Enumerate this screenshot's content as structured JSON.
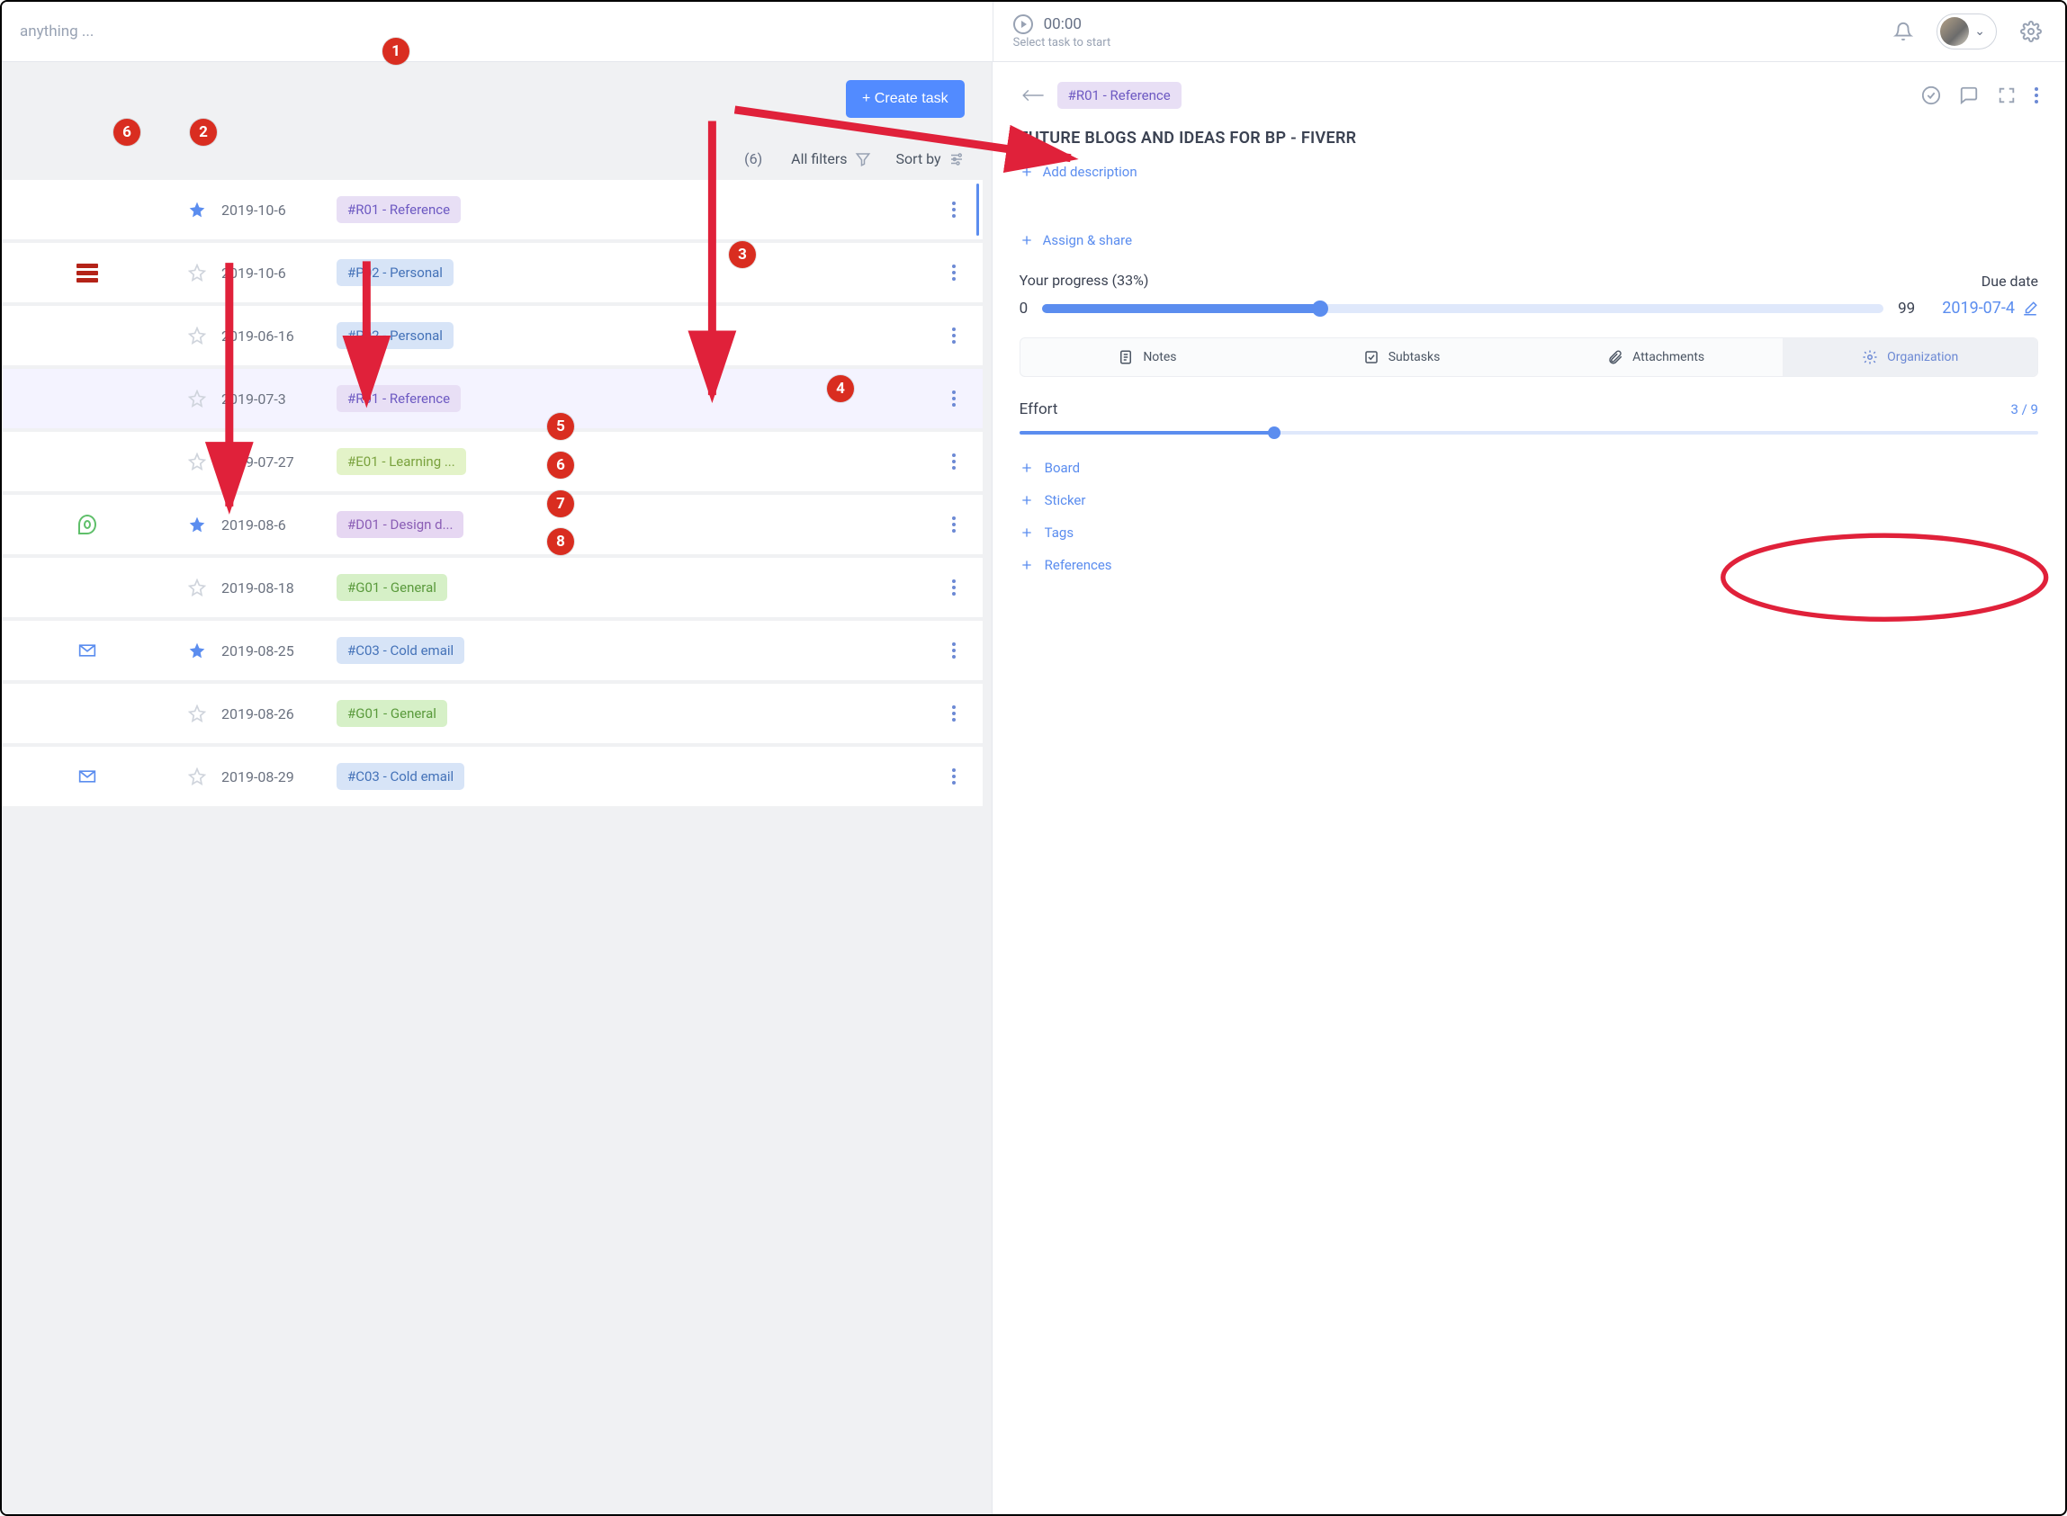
{
  "top": {
    "search_placeholder": "anything ...",
    "timer_time": "00:00",
    "timer_hint": "Select task to start"
  },
  "list": {
    "create_label": "+ Create task",
    "count_label": "(6)",
    "filters_label": "All filters",
    "sort_label": "Sort by",
    "rows": [
      {
        "date": "2019-10-6",
        "tag_text": "#R01 - Reference",
        "tag_class": "b-purple",
        "star": "fill",
        "sticker": "",
        "indicator": true
      },
      {
        "date": "2019-10-6",
        "tag_text": "#P02 - Personal",
        "tag_class": "b-blue",
        "star": "outline",
        "sticker": "stack"
      },
      {
        "date": "2019-06-16",
        "tag_text": "#P02 - Personal",
        "tag_class": "b-blue",
        "star": "outline",
        "sticker": ""
      },
      {
        "date": "2019-07-3",
        "tag_text": "#R01 - Reference",
        "tag_class": "b-purple",
        "star": "outline",
        "sticker": "",
        "selected": true
      },
      {
        "date": "2019-07-27",
        "tag_text": "#E01 - Learning ...",
        "tag_class": "b-lime",
        "star": "outline",
        "sticker": ""
      },
      {
        "date": "2019-08-6",
        "tag_text": "#D01 - Design d...",
        "tag_class": "b-violet",
        "star": "fill",
        "sticker": "spiral"
      },
      {
        "date": "2019-08-18",
        "tag_text": "#G01 - General",
        "tag_class": "b-green",
        "star": "outline",
        "sticker": ""
      },
      {
        "date": "2019-08-25",
        "tag_text": "#C03 - Cold email",
        "tag_class": "b-blue",
        "star": "fill",
        "sticker": "envelope"
      },
      {
        "date": "2019-08-26",
        "tag_text": "#G01 - General",
        "tag_class": "b-green",
        "star": "outline",
        "sticker": ""
      },
      {
        "date": "2019-08-29",
        "tag_text": "#C03 - Cold email",
        "tag_class": "b-blue",
        "star": "outline",
        "sticker": "envelope"
      }
    ]
  },
  "detail": {
    "tag_text": "#R01 - Reference",
    "title": "FUTURE BLOGS AND IDEAS FOR BP - FIVERR",
    "add_description": "Add description",
    "assign_share": "Assign & share",
    "progress_label": "Your progress  (33%)",
    "progress_min": "0",
    "progress_max": "99",
    "progress_percent": 33,
    "due_label": "Due date",
    "due_value": "2019-07-4",
    "tabs": {
      "notes": "Notes",
      "subtasks": "Subtasks",
      "attachments": "Attachments",
      "organization": "Organization"
    },
    "effort_label": "Effort",
    "effort_display": "3 / 9",
    "effort_percent": 25,
    "adds": {
      "board": "Board",
      "sticker": "Sticker",
      "tags": "Tags",
      "references": "References"
    }
  },
  "markers": [
    "1",
    "2",
    "3",
    "4",
    "5",
    "6",
    "7",
    "8",
    "6"
  ]
}
